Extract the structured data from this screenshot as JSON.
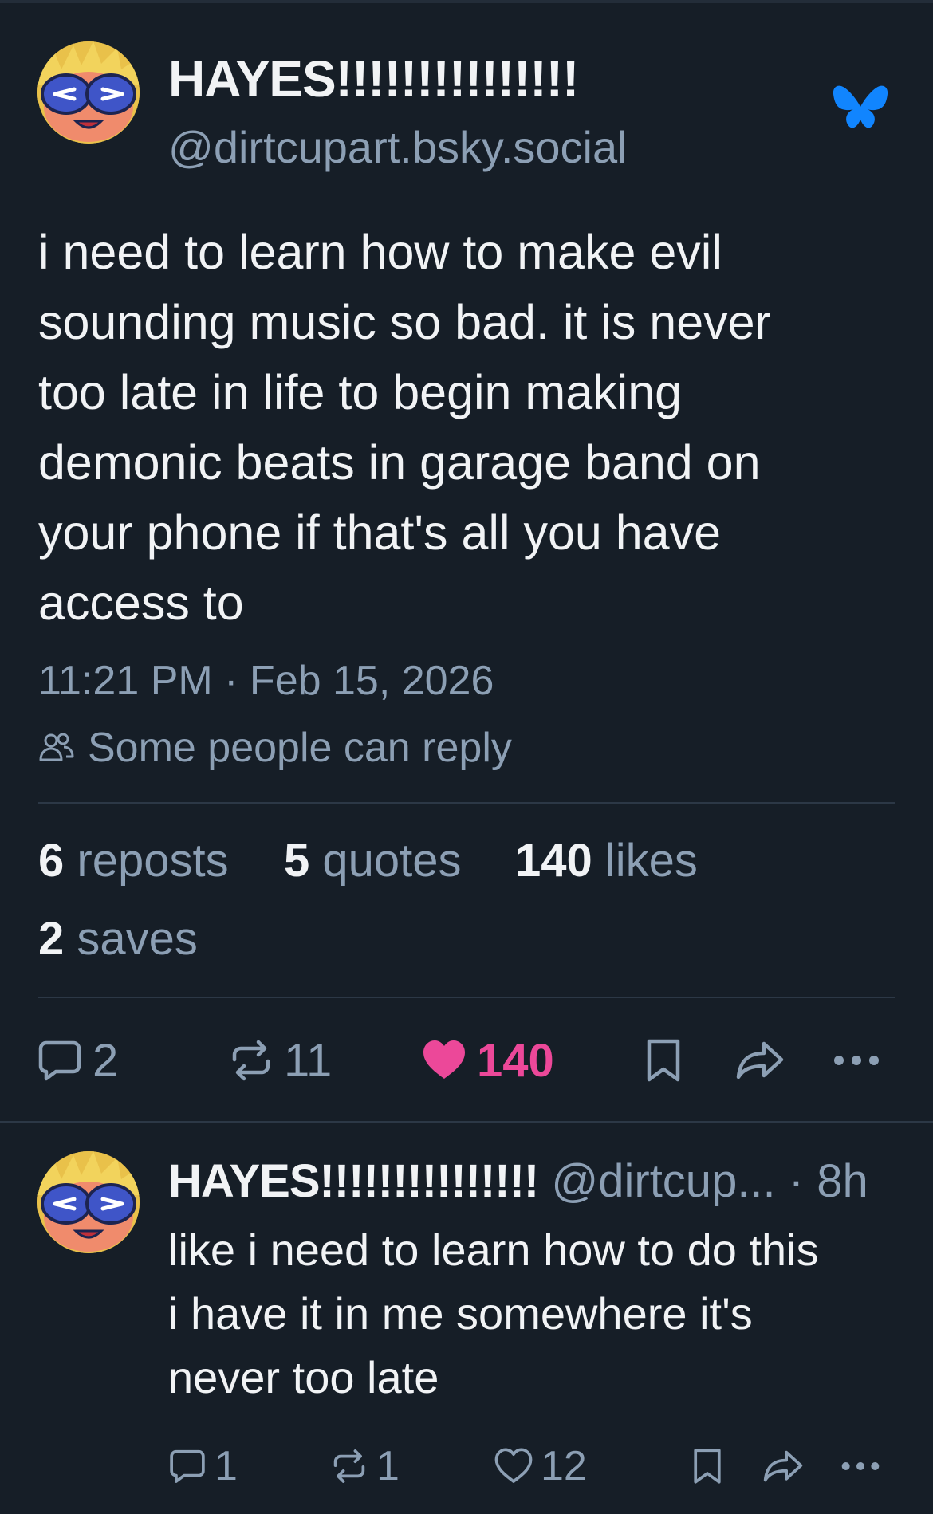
{
  "post": {
    "author": {
      "display_name": "HAYES!!!!!!!!!!!!!!!",
      "handle": "@dirtcupart.bsky.social"
    },
    "text_lines": [
      "i need to learn how to make evil",
      "sounding music so bad. it is never",
      "too late in life to begin making",
      "demonic beats in garage band on",
      "your phone if that's all you have",
      "access to"
    ],
    "timestamp": "11:21 PM · Feb 15, 2026",
    "reply_setting": "Some people can reply",
    "stats": {
      "reposts_count": "6",
      "reposts_label": "reposts",
      "quotes_count": "5",
      "quotes_label": "quotes",
      "likes_count": "140",
      "likes_label": "likes",
      "saves_count": "2",
      "saves_label": "saves"
    },
    "actions": {
      "reply_count": "2",
      "repost_count": "11",
      "like_count": "140",
      "liked": true
    }
  },
  "reply": {
    "author_name": "HAYES!!!!!!!!!!!!!!!",
    "author_handle": "@dirtcup...",
    "separator": "·",
    "time": "8h",
    "text_lines": [
      "like i need to learn how to do this",
      "i have it in me somewhere it's",
      "never too late"
    ],
    "actions": {
      "reply_count": "1",
      "repost_count": "1",
      "like_count": "12"
    }
  },
  "icons": {
    "brand": "butterfly-icon",
    "reply_setting": "people-icon",
    "reply": "comment-icon",
    "repost": "repost-icon",
    "like": "heart-icon",
    "bookmark": "bookmark-icon",
    "share": "share-icon",
    "more": "more-icon"
  },
  "colors": {
    "background": "#161e27",
    "text_primary": "#f1f3f5",
    "text_secondary": "#8c9fb4",
    "divider": "#2c3846",
    "brand_blue": "#1185fe",
    "like_pink": "#ec4899"
  }
}
